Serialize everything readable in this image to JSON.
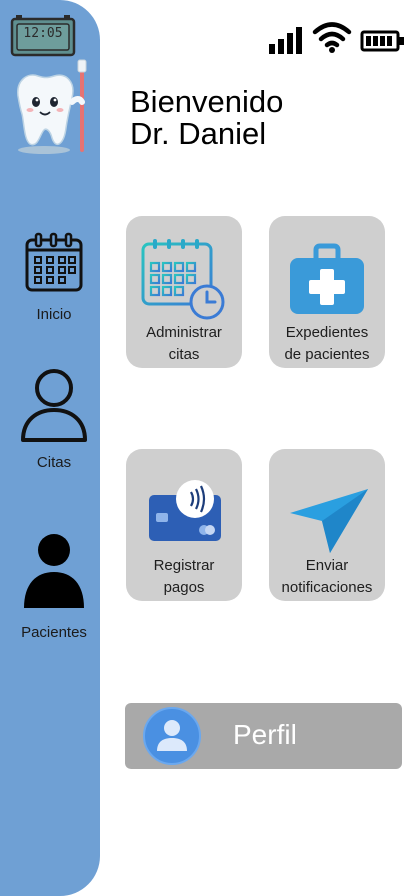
{
  "status_bar": {
    "clock_time": "12:05",
    "signal_icon": "signal-bars-icon",
    "wifi_icon": "wifi-icon",
    "battery_icon": "battery-icon"
  },
  "sidebar": {
    "logo": "tooth-mascot",
    "items": [
      {
        "label": "Inicio",
        "icon": "calendar-icon"
      },
      {
        "label": "Citas",
        "icon": "user-outline-icon"
      },
      {
        "label": "Pacientes",
        "icon": "user-filled-icon"
      }
    ]
  },
  "header": {
    "greeting_line1": "Bienvenido",
    "greeting_line2": "Dr. Daniel"
  },
  "cards": [
    {
      "label_line1": "Administrar",
      "label_line2": "citas",
      "icon": "calendar-clock-icon"
    },
    {
      "label_line1": "Expedientes",
      "label_line2": "de pacientes",
      "icon": "medical-case-icon"
    },
    {
      "label_line1": "Registrar",
      "label_line2": "pagos",
      "icon": "credit-card-icon"
    },
    {
      "label_line1": "Enviar",
      "label_line2": "notificaciones",
      "icon": "paper-plane-icon"
    }
  ],
  "profile": {
    "label": "Perfil",
    "icon": "avatar-icon"
  },
  "colors": {
    "sidebar": "#6fa0d4",
    "card": "#cfcfcf",
    "profile_button": "#a9a9a9",
    "accent_blue": "#3a9ad9"
  }
}
